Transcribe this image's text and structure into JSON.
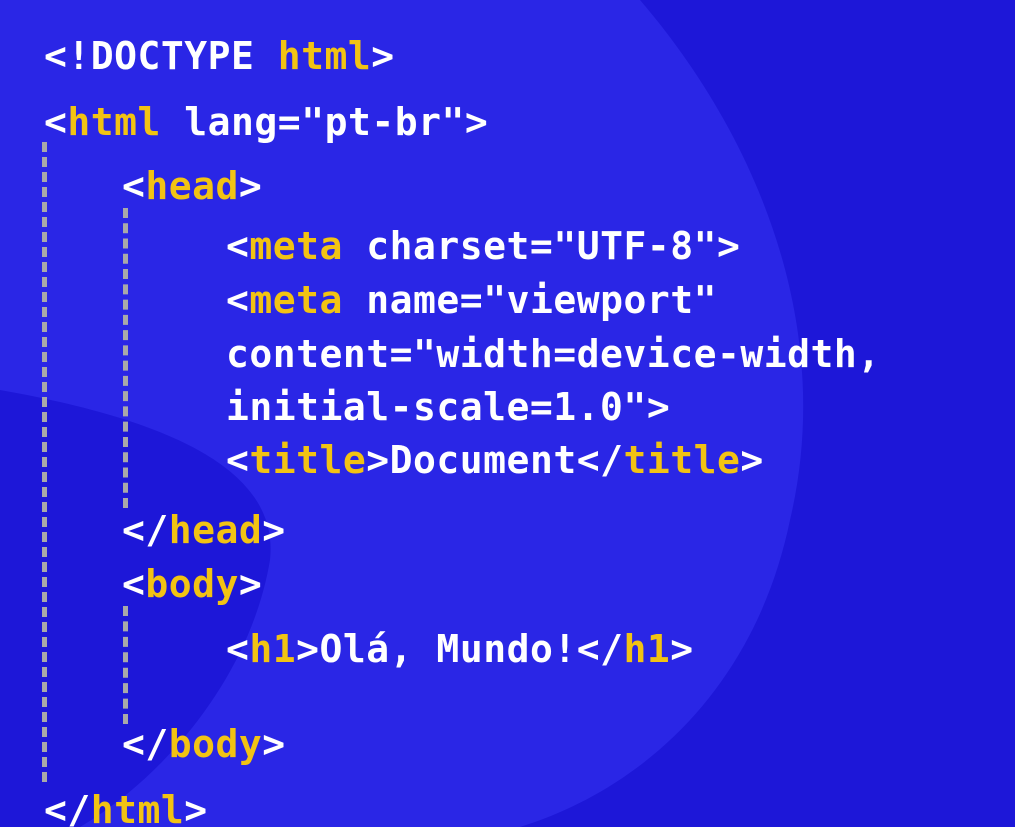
{
  "colors": {
    "background": "#1d17d8",
    "blob": "#2a26e6",
    "tag": "#f2c313",
    "punct": "#ffffff",
    "attr": "#ffffff",
    "string": "#c7c7c7",
    "text": "#ffffff",
    "guide": "#a9a9a9"
  },
  "code": [
    {
      "id": "doctype",
      "tokens": [
        [
          "punct",
          "<!DOCTYPE "
        ],
        [
          "tag",
          "html"
        ],
        [
          "punct",
          ">"
        ]
      ]
    },
    {
      "id": "html-open",
      "tokens": [
        [
          "punct",
          "<"
        ],
        [
          "tag",
          "html"
        ],
        [
          "attr",
          " lang="
        ],
        [
          "str",
          "\"pt-br\""
        ],
        [
          "punct",
          ">"
        ]
      ]
    },
    {
      "id": "head-open",
      "tokens": [
        [
          "punct",
          "<"
        ],
        [
          "tag",
          "head"
        ],
        [
          "punct",
          ">"
        ]
      ]
    },
    {
      "id": "meta-charset",
      "tokens": [
        [
          "punct",
          "<"
        ],
        [
          "tag",
          "meta"
        ],
        [
          "attr",
          " charset="
        ],
        [
          "str",
          "\"UTF-8\""
        ],
        [
          "punct",
          ">"
        ]
      ]
    },
    {
      "id": "meta-viewport",
      "tokens": [
        [
          "punct",
          "<"
        ],
        [
          "tag",
          "meta"
        ],
        [
          "attr",
          " name="
        ],
        [
          "str",
          "\"viewport\""
        ]
      ]
    },
    {
      "id": "meta-content",
      "tokens": [
        [
          "attr",
          "content="
        ],
        [
          "str",
          "\"width=device-width,"
        ]
      ]
    },
    {
      "id": "meta-scale",
      "tokens": [
        [
          "str",
          "initial-scale=1.0\""
        ],
        [
          "punct",
          ">"
        ]
      ]
    },
    {
      "id": "title",
      "tokens": [
        [
          "punct",
          "<"
        ],
        [
          "tag",
          "title"
        ],
        [
          "punct",
          ">"
        ],
        [
          "text",
          "Document"
        ],
        [
          "punct",
          "</"
        ],
        [
          "tag",
          "title"
        ],
        [
          "punct",
          ">"
        ]
      ]
    },
    {
      "id": "head-close",
      "tokens": [
        [
          "punct",
          "</"
        ],
        [
          "tag",
          "head"
        ],
        [
          "punct",
          ">"
        ]
      ]
    },
    {
      "id": "body-open",
      "tokens": [
        [
          "punct",
          "<"
        ],
        [
          "tag",
          "body"
        ],
        [
          "punct",
          ">"
        ]
      ]
    },
    {
      "id": "h1",
      "tokens": [
        [
          "punct",
          "<"
        ],
        [
          "tag",
          "h1"
        ],
        [
          "punct",
          ">"
        ],
        [
          "text",
          "Olá, Mundo!"
        ],
        [
          "punct",
          "</"
        ],
        [
          "tag",
          "h1"
        ],
        [
          "punct",
          ">"
        ]
      ]
    },
    {
      "id": "body-close",
      "tokens": [
        [
          "punct",
          "</"
        ],
        [
          "tag",
          "body"
        ],
        [
          "punct",
          ">"
        ]
      ]
    },
    {
      "id": "html-close",
      "tokens": [
        [
          "punct",
          "</"
        ],
        [
          "tag",
          "html"
        ],
        [
          "punct",
          ">"
        ]
      ]
    }
  ]
}
